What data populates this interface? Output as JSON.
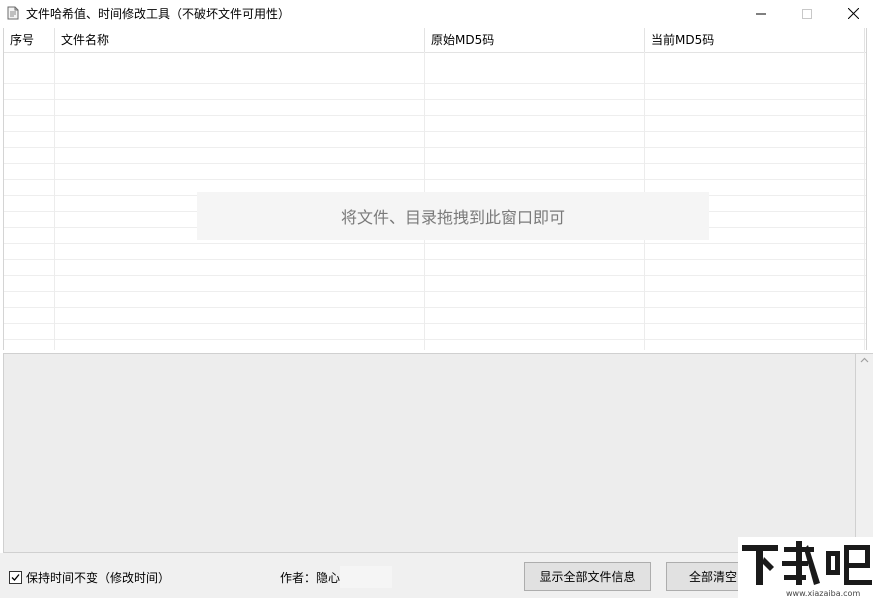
{
  "window": {
    "title": "文件哈希值、时间修改工具（不破坏文件可用性）"
  },
  "listview": {
    "columns": [
      "序号",
      "文件名称",
      "原始MD5码",
      "当前MD5码"
    ],
    "empty_hint": "将文件、目录拖拽到此窗口即可"
  },
  "footer": {
    "keep_time_label": "保持时间不变（修改时间）",
    "keep_time_checked": true,
    "author_label": "作者：隐心",
    "show_all_button": "显示全部文件信息",
    "clear_all_button": "全部清空"
  },
  "watermark": {
    "text": "下载吧",
    "url": "www.xiazaiba.com"
  },
  "icons": [
    "app-icon",
    "minimize-icon",
    "maximize-icon",
    "close-icon",
    "scroll-up-icon",
    "scroll-down-icon",
    "check-icon"
  ]
}
